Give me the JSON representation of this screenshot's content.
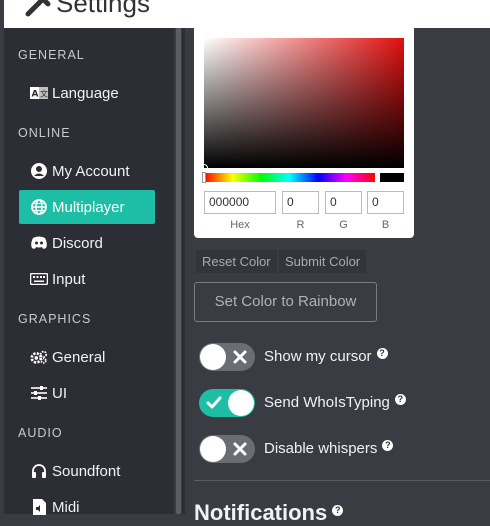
{
  "window": {
    "title": "Settings"
  },
  "sidebar": {
    "sections": [
      {
        "label": "GENERAL"
      },
      {
        "label": "ONLINE"
      },
      {
        "label": "GRAPHICS"
      },
      {
        "label": "AUDIO"
      }
    ],
    "items": [
      {
        "label": "Language",
        "icon": "language-icon"
      },
      {
        "label": "My Account",
        "icon": "account-icon"
      },
      {
        "label": "Multiplayer",
        "icon": "globe-icon",
        "active": true
      },
      {
        "label": "Discord",
        "icon": "discord-icon"
      },
      {
        "label": "Input",
        "icon": "keyboard-icon"
      },
      {
        "label": "General",
        "icon": "gears-icon"
      },
      {
        "label": "UI",
        "icon": "sliders-icon"
      },
      {
        "label": "Soundfont",
        "icon": "headphones-icon"
      },
      {
        "label": "Midi",
        "icon": "file-audio-icon"
      }
    ]
  },
  "color_picker": {
    "hex_value": "000000",
    "r_value": "0",
    "g_value": "0",
    "b_value": "0",
    "hex_label": "Hex",
    "r_label": "R",
    "g_label": "G",
    "b_label": "B",
    "selected_color": "#000000"
  },
  "buttons": {
    "reset_color": "Reset Color",
    "submit_color": "Submit Color",
    "set_rainbow": "Set Color to Rainbow"
  },
  "toggles": [
    {
      "label": "Show my cursor",
      "on": false
    },
    {
      "label": "Send WhoIsTyping",
      "on": true
    },
    {
      "label": "Disable whispers",
      "on": false
    }
  ],
  "next_section": {
    "label": "Notifications"
  },
  "colors": {
    "accent": "#1ebea6",
    "sidebar_bg": "#2d2e35",
    "main_bg": "#3a3c44"
  }
}
